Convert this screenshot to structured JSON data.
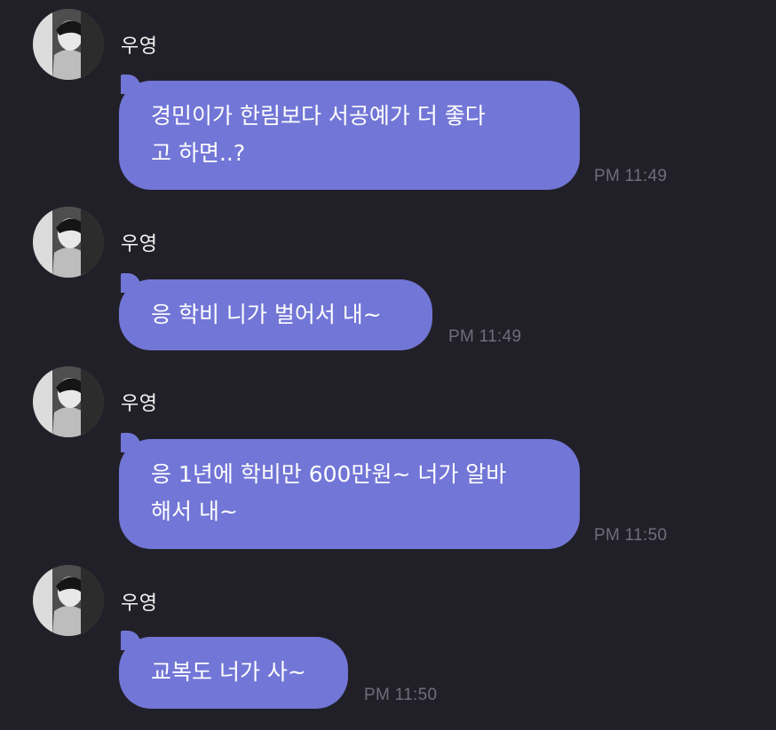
{
  "chat": {
    "messages": [
      {
        "sender": "우영",
        "text": "경민이가 한림보다 서공예가 더 좋다\n고 하면..?",
        "time": "PM 11:49"
      },
      {
        "sender": "우영",
        "text": "응 학비 니가 벌어서 내~",
        "time": "PM 11:49"
      },
      {
        "sender": "우영",
        "text": "응 1년에 학비만 600만원~ 너가 알바\n해서 내~",
        "time": "PM 11:50"
      },
      {
        "sender": "우영",
        "text": "교복도 너가 사~",
        "time": "PM 11:50"
      }
    ]
  }
}
